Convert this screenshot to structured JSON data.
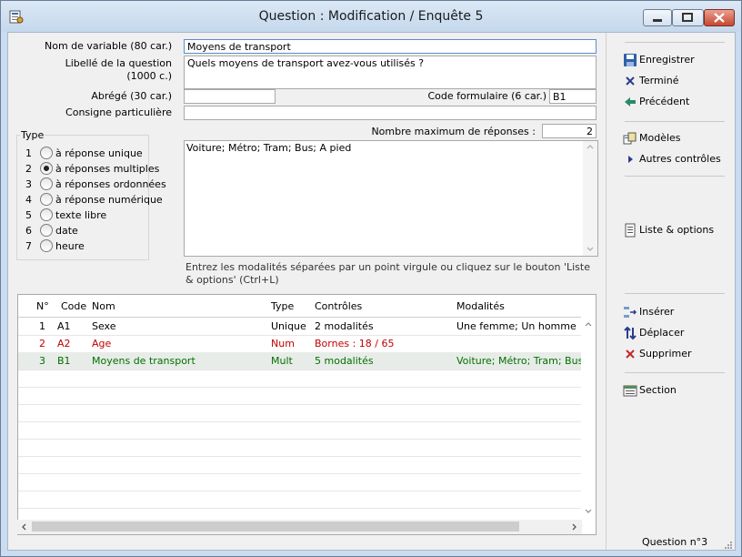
{
  "window": {
    "title": "Question : Modification / Enquête 5"
  },
  "form": {
    "varname_label": "Nom de variable (80 car.)",
    "varname_value": "Moyens de transport",
    "libelle_label_line1": "Libellé de la question",
    "libelle_label_line2": "(1000 c.)",
    "libelle_value": "Quels moyens de transport avez-vous utilisés ?",
    "abrege_label": "Abrégé (30 car.)",
    "abrege_value": "",
    "code_label": "Code formulaire  (6 car.)",
    "code_value": "B1",
    "consigne_label": "Consigne particulière",
    "consigne_value": "",
    "max_label": "Nombre maximum de réponses :",
    "max_value": "2"
  },
  "type_group": {
    "title": "Type",
    "selected": 2,
    "options": [
      {
        "num": "1",
        "label": "à réponse unique"
      },
      {
        "num": "2",
        "label": "à réponses multiples"
      },
      {
        "num": "3",
        "label": "à réponses ordonnées"
      },
      {
        "num": "4",
        "label": "à réponse numérique"
      },
      {
        "num": "5",
        "label": "texte libre"
      },
      {
        "num": "6",
        "label": "date"
      },
      {
        "num": "7",
        "label": "heure"
      }
    ]
  },
  "modalites_text": "Voiture; Métro; Tram; Bus; A pied",
  "hint_text": "Entrez les modalités séparées par un point virgule ou cliquez sur le bouton 'Liste & options' (Ctrl+L)",
  "table": {
    "headers": [
      "N°",
      "Code",
      "Nom",
      "Type",
      "Contrôles",
      "Modalités"
    ],
    "rows": [
      {
        "n": "1",
        "code": "A1",
        "nom": "Sexe",
        "type": "Unique",
        "controles": "2 modalités",
        "modalites": "Une femme; Un homme",
        "color": "#000000"
      },
      {
        "n": "2",
        "code": "A2",
        "nom": "Age",
        "type": "Num",
        "controles": "Bornes : 18 / 65",
        "modalites": "",
        "color": "#c00000"
      },
      {
        "n": "3",
        "code": "B1",
        "nom": "Moyens de transport",
        "type": "Mult",
        "controles": "5 modalités",
        "modalites": "Voiture; Métro; Tram; Bus; A",
        "color": "#007000"
      }
    ]
  },
  "actions": {
    "enregistrer": "Enregistrer",
    "termine": "Terminé",
    "precedent": "Précédent",
    "modeles": "Modèles",
    "autres": "Autres contrôles",
    "liste": "Liste & options",
    "inserer": "Insérer",
    "deplacer": "Déplacer",
    "supprimer": "Supprimer",
    "section": "Section"
  },
  "status": "Question n°3"
}
